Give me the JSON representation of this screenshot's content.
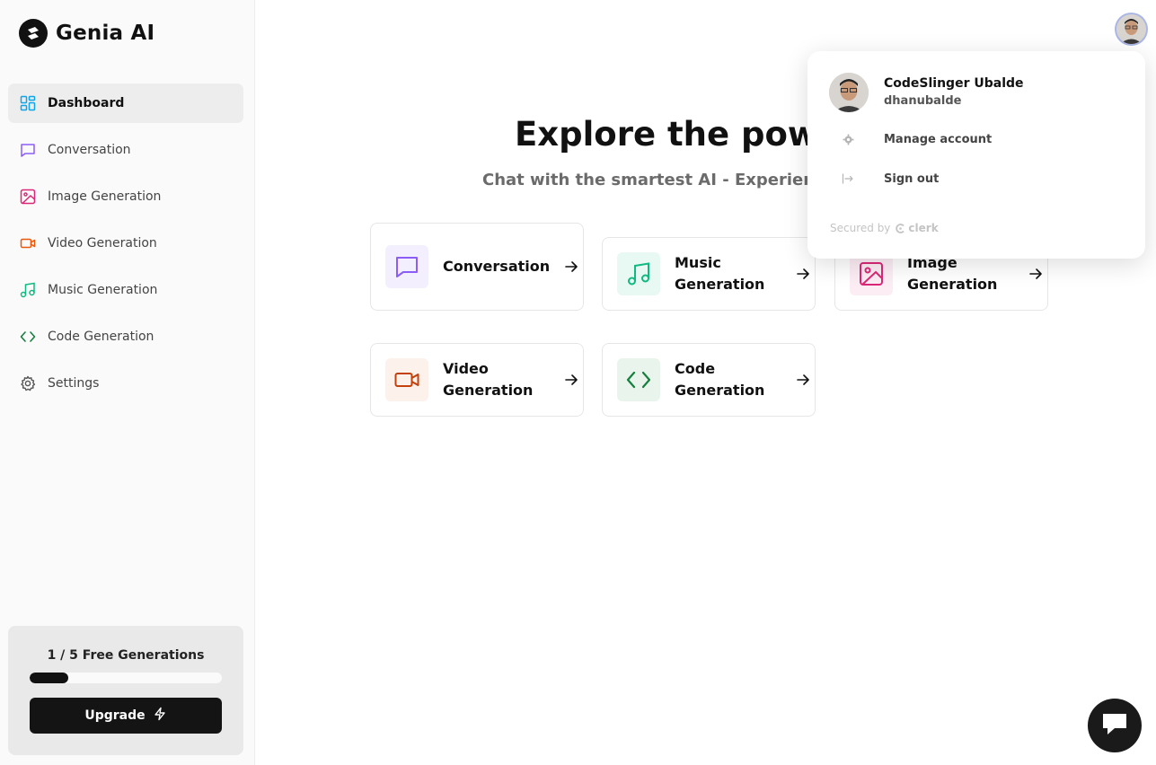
{
  "brand": {
    "name": "Genia AI"
  },
  "nav": {
    "items": [
      {
        "label": "Dashboard",
        "icon": "layout-dashboard-icon",
        "color": "#0ea5e9",
        "active": true
      },
      {
        "label": "Conversation",
        "icon": "message-square-icon",
        "color": "#8b5cf6"
      },
      {
        "label": "Image Generation",
        "icon": "image-icon",
        "color": "#db2777"
      },
      {
        "label": "Video Generation",
        "icon": "video-icon",
        "color": "#ea580c"
      },
      {
        "label": "Music Generation",
        "icon": "music-icon",
        "color": "#10b981"
      },
      {
        "label": "Code Generation",
        "icon": "code-icon",
        "color": "#15803d"
      },
      {
        "label": "Settings",
        "icon": "settings-icon",
        "color": "#555555"
      }
    ]
  },
  "usage": {
    "text": "1 / 5 Free Generations",
    "used": 1,
    "limit": 5,
    "upgrade_label": "Upgrade"
  },
  "hero": {
    "title": "Explore the powe",
    "subtitle": "Chat with the smartest AI - Experience"
  },
  "tools": [
    {
      "label": "Conversation",
      "icon": "message-square-icon",
      "color": "#8b5cf6",
      "bg": "#f3effe"
    },
    {
      "label": "Music Generation",
      "icon": "music-icon",
      "color": "#10b981",
      "bg": "#e8f8f2"
    },
    {
      "label": "Image Generation",
      "icon": "image-icon",
      "color": "#db2777",
      "bg": "#fcedf4"
    },
    {
      "label": "Video Generation",
      "icon": "video-icon",
      "color": "#c2410c",
      "bg": "#fdf1ec"
    },
    {
      "label": "Code Generation",
      "icon": "code-icon",
      "color": "#15803d",
      "bg": "#e9f5ec"
    }
  ],
  "user": {
    "name": "CodeSlinger Ubalde",
    "username": "dhanubalde",
    "actions": [
      {
        "label": "Manage account",
        "icon": "gear-icon"
      },
      {
        "label": "Sign out",
        "icon": "sign-out-icon"
      }
    ],
    "secured_by": "Secured by",
    "provider": "clerk"
  },
  "colors": {
    "accent_dark": "#111111",
    "sidebar_bg": "#fafafa"
  }
}
